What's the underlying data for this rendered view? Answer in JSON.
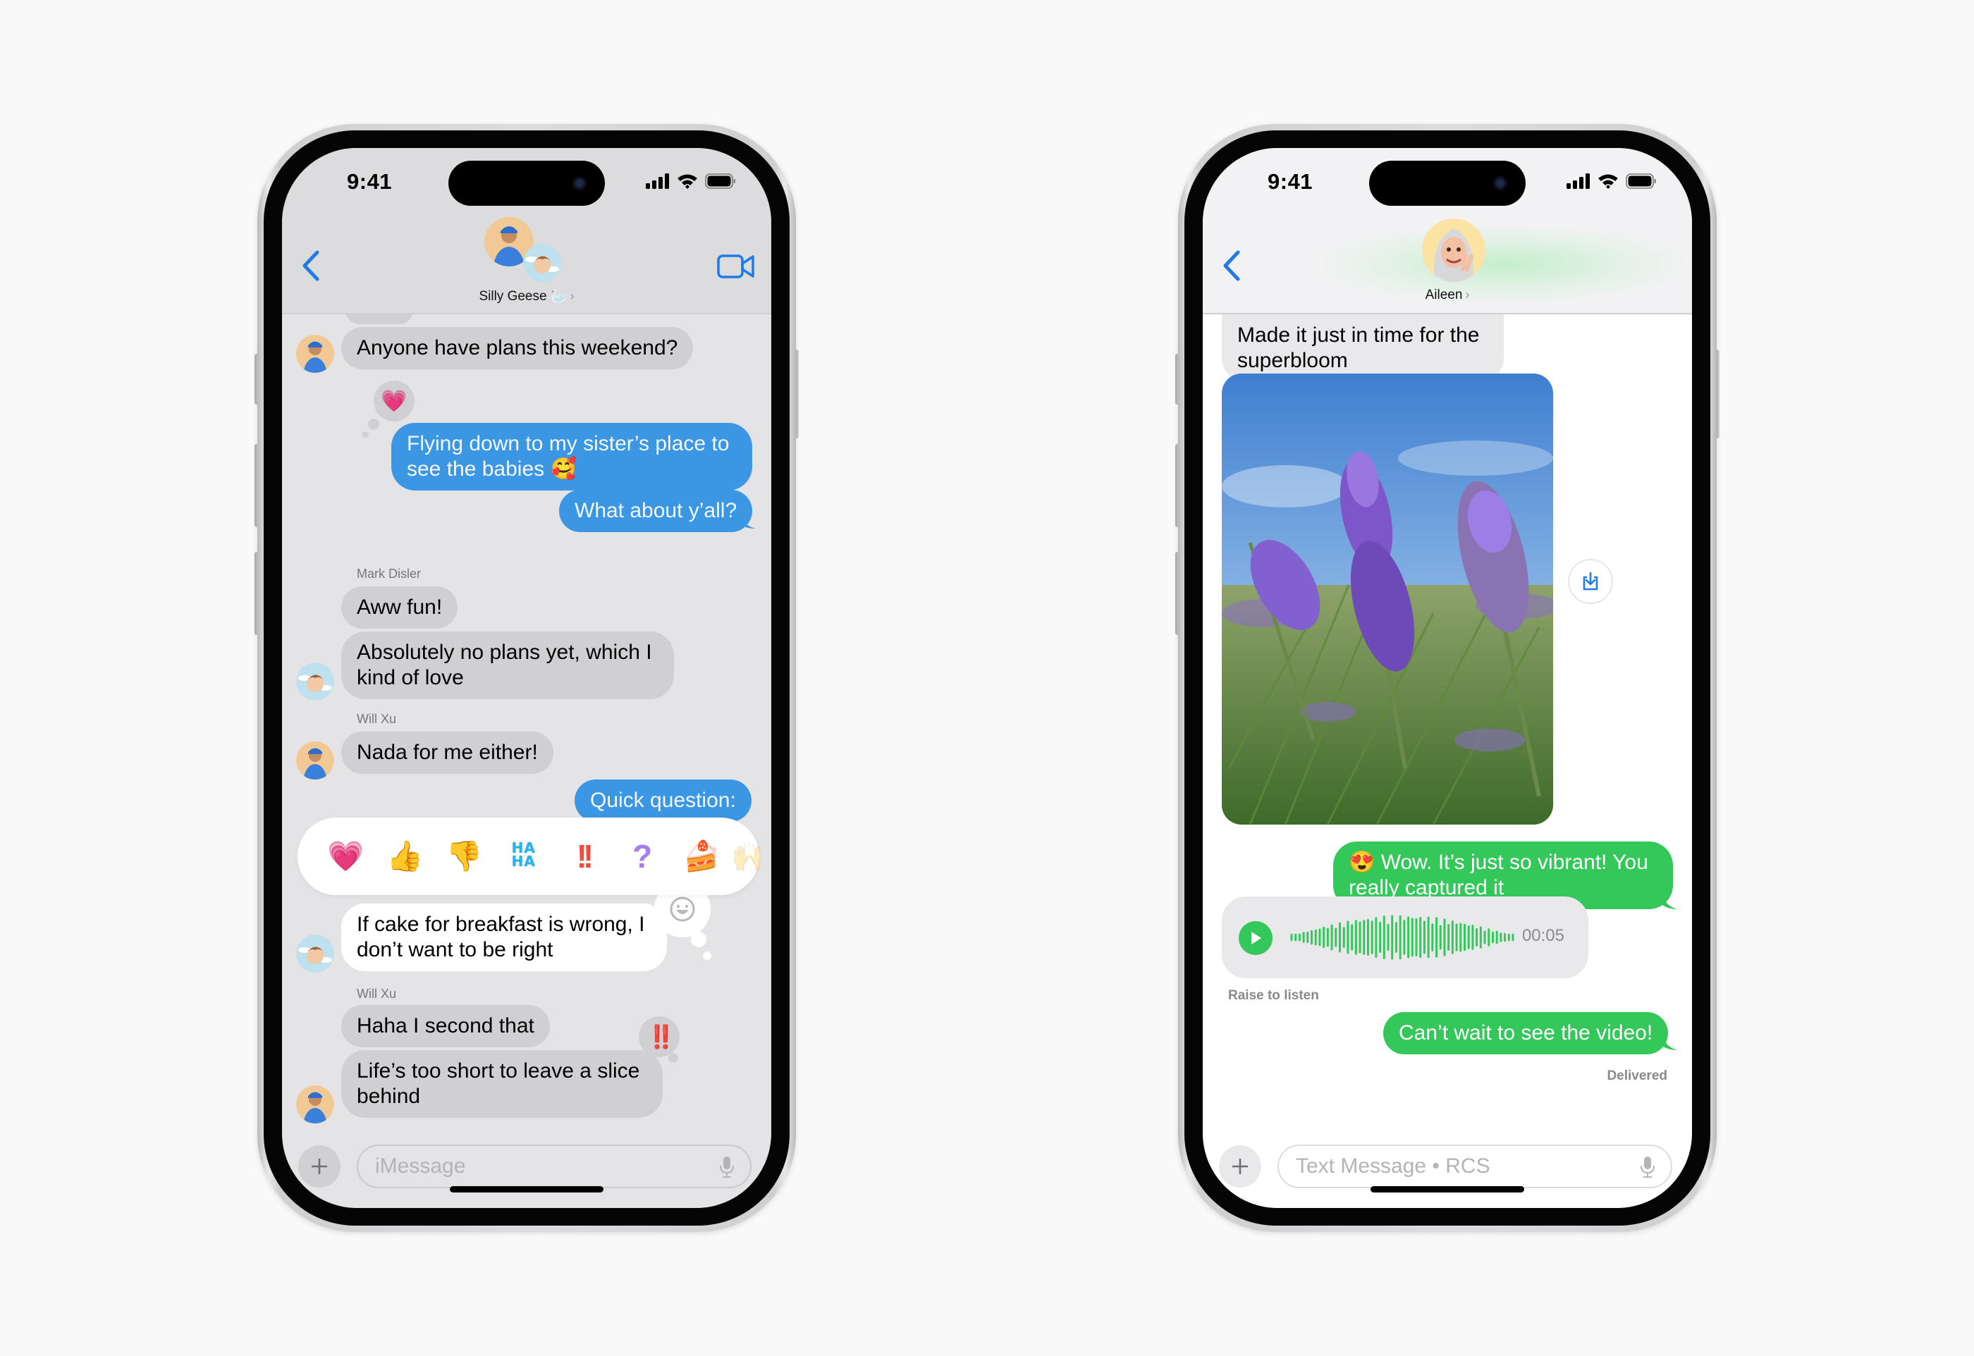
{
  "left_phone": {
    "status": {
      "time": "9:41"
    },
    "header": {
      "title": "Silly Geese",
      "title_emoji": "🦢",
      "chevron": "›",
      "back_icon": "chevron-left",
      "video_icon": "video-camera"
    },
    "messages": [
      {
        "id": "m1",
        "type": "received",
        "text": "Anyone have plans this weekend?",
        "avatar": "memoji-blue-beanie"
      },
      {
        "id": "m2",
        "type": "sent",
        "text": "Flying down to my sister’s place to see the babies 🥰",
        "reaction": "💗"
      },
      {
        "id": "m3",
        "type": "sent",
        "text": "What about y’all?"
      },
      {
        "id": "s1",
        "type": "sender_label",
        "text": "Mark Disler"
      },
      {
        "id": "m4",
        "type": "received",
        "text": "Aww fun!"
      },
      {
        "id": "m5",
        "type": "received",
        "text": "Absolutely no plans yet, which I kind of love",
        "avatar": "memoji-clouds"
      },
      {
        "id": "s2",
        "type": "sender_label",
        "text": "Will Xu"
      },
      {
        "id": "m6",
        "type": "received",
        "text": "Nada for me either!",
        "avatar": "memoji-blue-beanie"
      },
      {
        "id": "m7",
        "type": "sent",
        "text": "Quick question:"
      },
      {
        "id": "m8",
        "type": "received",
        "text": "If cake for breakfast is wrong, I don’t want to be right",
        "avatar": "memoji-clouds",
        "highlighted": true
      },
      {
        "id": "s3",
        "type": "sender_label",
        "text": "Will Xu"
      },
      {
        "id": "m9",
        "type": "received",
        "text": "Haha I second that"
      },
      {
        "id": "m10",
        "type": "received",
        "text": "Life’s too short to leave a slice behind",
        "avatar": "memoji-blue-beanie",
        "reaction": "‼️"
      }
    ],
    "tapback_bar": {
      "items": [
        {
          "name": "heart",
          "glyph": "💗"
        },
        {
          "name": "thumbs-up",
          "glyph": "👍"
        },
        {
          "name": "thumbs-down",
          "glyph": "👎"
        },
        {
          "name": "haha",
          "glyph": "HA HA"
        },
        {
          "name": "emphasis",
          "glyph": "!!"
        },
        {
          "name": "question",
          "glyph": "?"
        },
        {
          "name": "cake",
          "glyph": "🍰"
        },
        {
          "name": "more-faded",
          "glyph": "🙌"
        }
      ],
      "emoji_picker_icon": "smiley-face"
    },
    "composer": {
      "placeholder": "iMessage",
      "plus_icon": "plus",
      "mic_icon": "microphone"
    }
  },
  "right_phone": {
    "status": {
      "time": "9:41"
    },
    "header": {
      "title": "Aileen",
      "chevron": "›",
      "back_icon": "chevron-left"
    },
    "messages": [
      {
        "id": "r1",
        "type": "received",
        "text": "Made it just in time for the superbloom"
      },
      {
        "id": "r2",
        "type": "photo",
        "alt": "Close-up of lavender flowers against a blue sky"
      },
      {
        "id": "r3",
        "type": "sent",
        "text": "😍 Wow. It’s just so vibrant! You really captured it"
      },
      {
        "id": "r4",
        "type": "audio",
        "duration": "00:05",
        "caption": "Raise to listen"
      },
      {
        "id": "r5",
        "type": "sent",
        "text": "Can’t wait to see the video!",
        "status": "Delivered"
      }
    ],
    "save_icon": "save-to-photos",
    "composer": {
      "placeholder": "Text Message • RCS",
      "plus_icon": "plus",
      "mic_icon": "microphone"
    }
  },
  "colors": {
    "imessage_blue": "#3b96e3",
    "rcs_green": "#34c759",
    "ios_tint": "#1f7ae6",
    "received_gray": "#e9e9eb"
  }
}
